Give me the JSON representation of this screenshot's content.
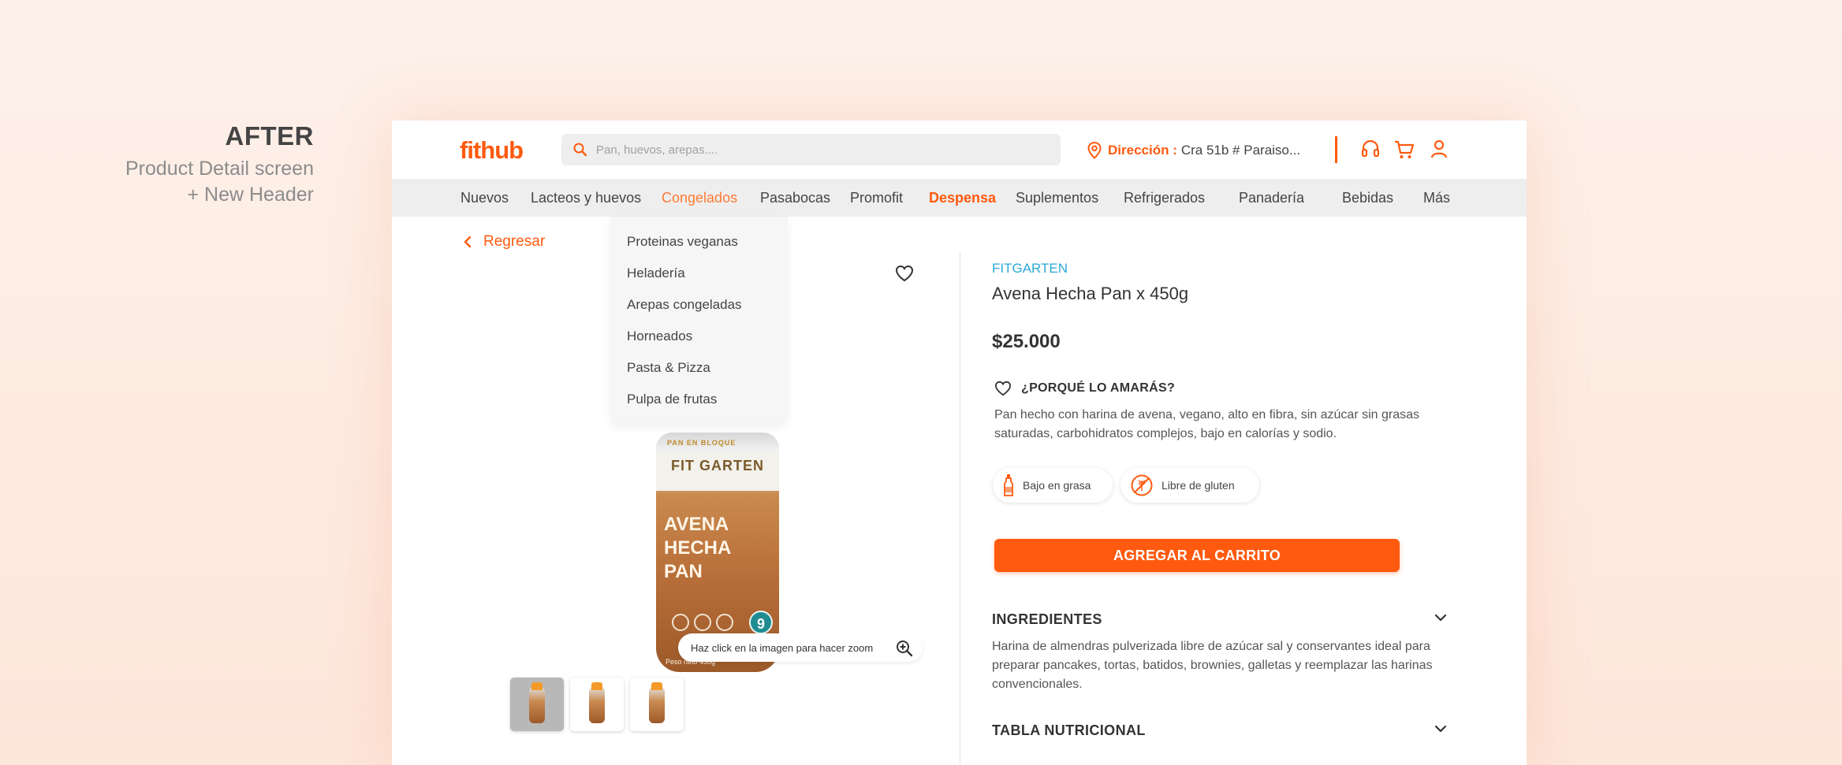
{
  "caption": {
    "title": "AFTER",
    "line1": "Product Detail screen",
    "line2": "+ New Header"
  },
  "header": {
    "logo": "fithub",
    "search_placeholder": "Pan, huevos, arepas....",
    "address_label": "Dirección :",
    "address_value": "Cra 51b # Paraiso...",
    "icons": [
      "support-headset-icon",
      "cart-icon",
      "user-icon"
    ]
  },
  "nav": {
    "items": [
      "Nuevos",
      "Lacteos y huevos",
      "Congelados",
      "Pasabocas",
      "Promofit",
      "Despensa",
      "Suplementos",
      "Refrigerados",
      "Panadería",
      "Bebidas",
      "Más"
    ],
    "active": "Congelados",
    "highlight": "Despensa"
  },
  "dropdown": {
    "items": [
      "Proteinas veganas",
      "Heladería",
      "Arepas congeladas",
      "Horneados",
      "Pasta & Pizza",
      "Pulpa de frutas"
    ]
  },
  "back_label": "Regresar",
  "product": {
    "zoom_hint": "Haz click en la imagen para hacer zoom",
    "package_band": "FIT GARTEN",
    "package_tag": "PAN EN BLOQUE",
    "package_name": "AVENA HECHA PAN",
    "package_number": "9",
    "package_weight": "Peso neto 450g",
    "thumbnails_count": 3,
    "brand": "FITGARTEN",
    "title": "Avena Hecha Pan x 450g",
    "price": "$25.000",
    "why_title": "¿PORQUÉ LO AMARÁS?",
    "description": "Pan  hecho con harina de avena, vegano, alto en fibra, sin azúcar sin grasas saturadas, carbohidratos complejos, bajo en calorías y sodio.",
    "badges": [
      "Bajo en grasa",
      "Libre de gluten"
    ],
    "add_to_cart": "AGREGAR AL CARRITO",
    "ingredients_title": "INGREDIENTES",
    "ingredients_text": "Harina de almendras pulverizada libre de azúcar sal y conservantes ideal para preparar pancakes, tortas, batidos, brownies, galletas y reemplazar las harinas convencionales.",
    "nutrition_title": "TABLA  NUTRICIONAL"
  },
  "colors": {
    "accent": "#ff5a0f",
    "brand_blue": "#2aa9d6",
    "nav_bg": "#eeeeee"
  }
}
